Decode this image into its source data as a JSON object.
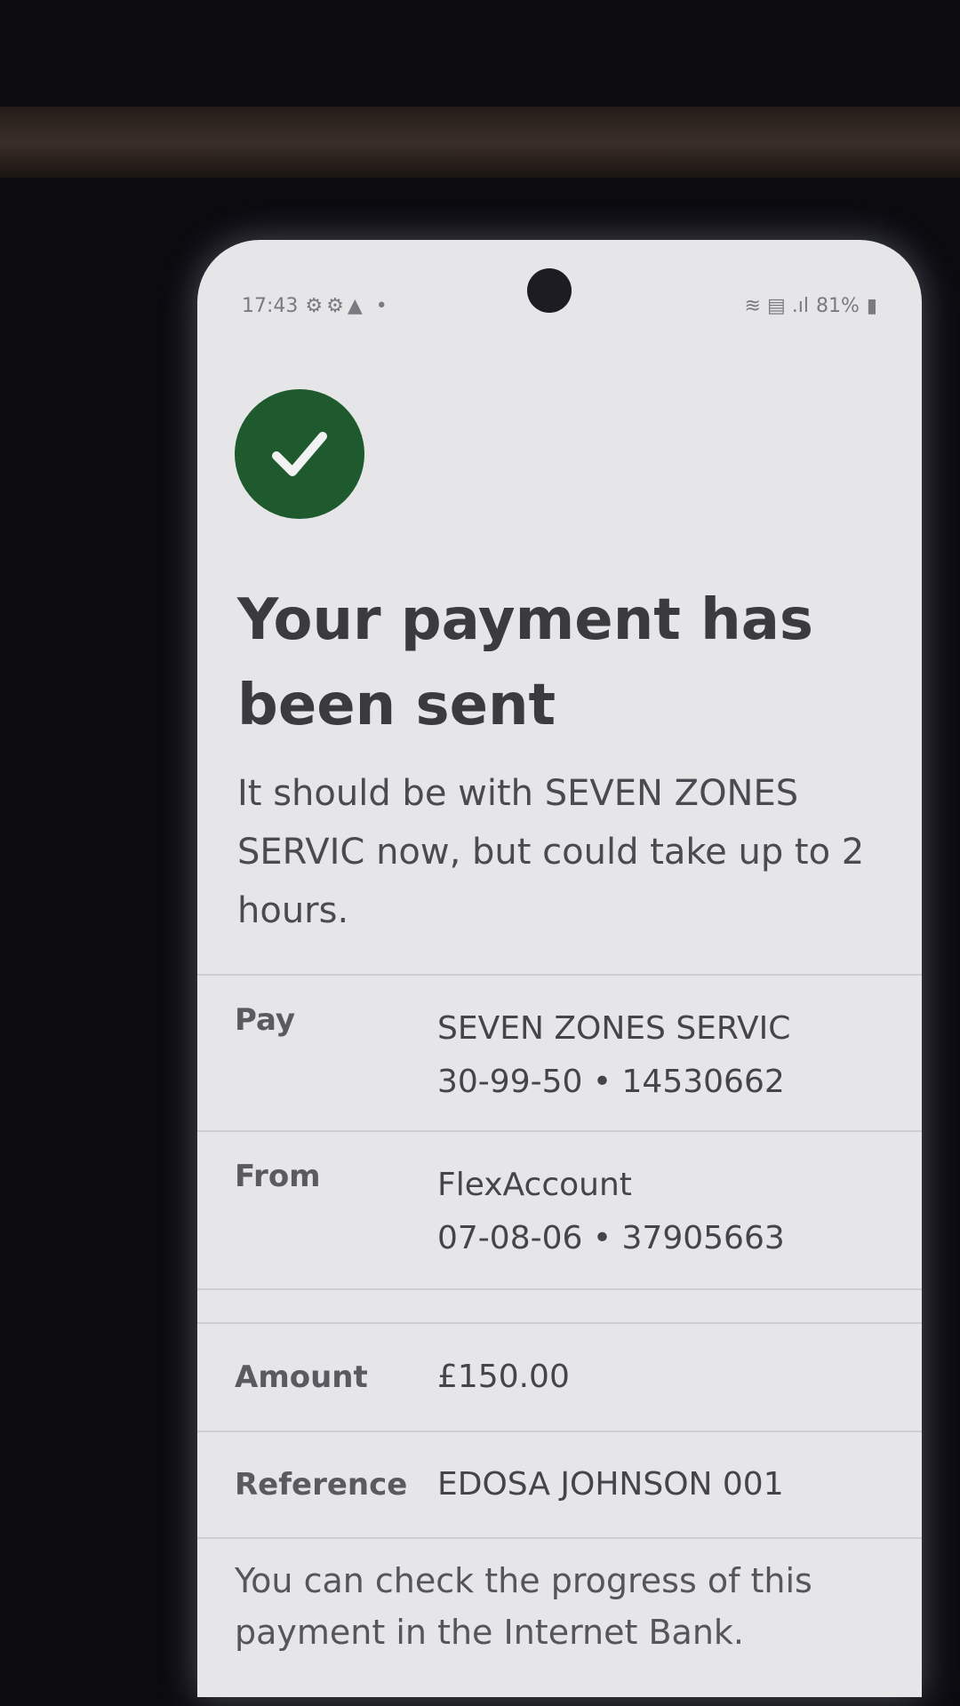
{
  "status_bar": {
    "time": "17:43",
    "notif_icons": "⚙⚙▲ •",
    "right_icons": "≋ ▤ .ıl",
    "battery": "81%"
  },
  "confirmation": {
    "title": "Your payment has been sent",
    "message": "It should be with SEVEN ZONES SERVIC now, but could take up to 2 hours."
  },
  "details": {
    "pay": {
      "label": "Pay",
      "name": "SEVEN ZONES SERVIC",
      "account": "30-99-50 • 14530662"
    },
    "from": {
      "label": "From",
      "name": "FlexAccount",
      "account": "07-08-06 • 37905663"
    },
    "amount": {
      "label": "Amount",
      "value": "£150.00"
    },
    "reference": {
      "label": "Reference",
      "value": "EDOSA JOHNSON 001"
    }
  },
  "footer": {
    "note": "You can check the progress of this payment in the Internet Bank."
  },
  "colors": {
    "success_green": "#1e5a2e",
    "background": "#e6e6e8",
    "text": "#3a3a3f"
  }
}
